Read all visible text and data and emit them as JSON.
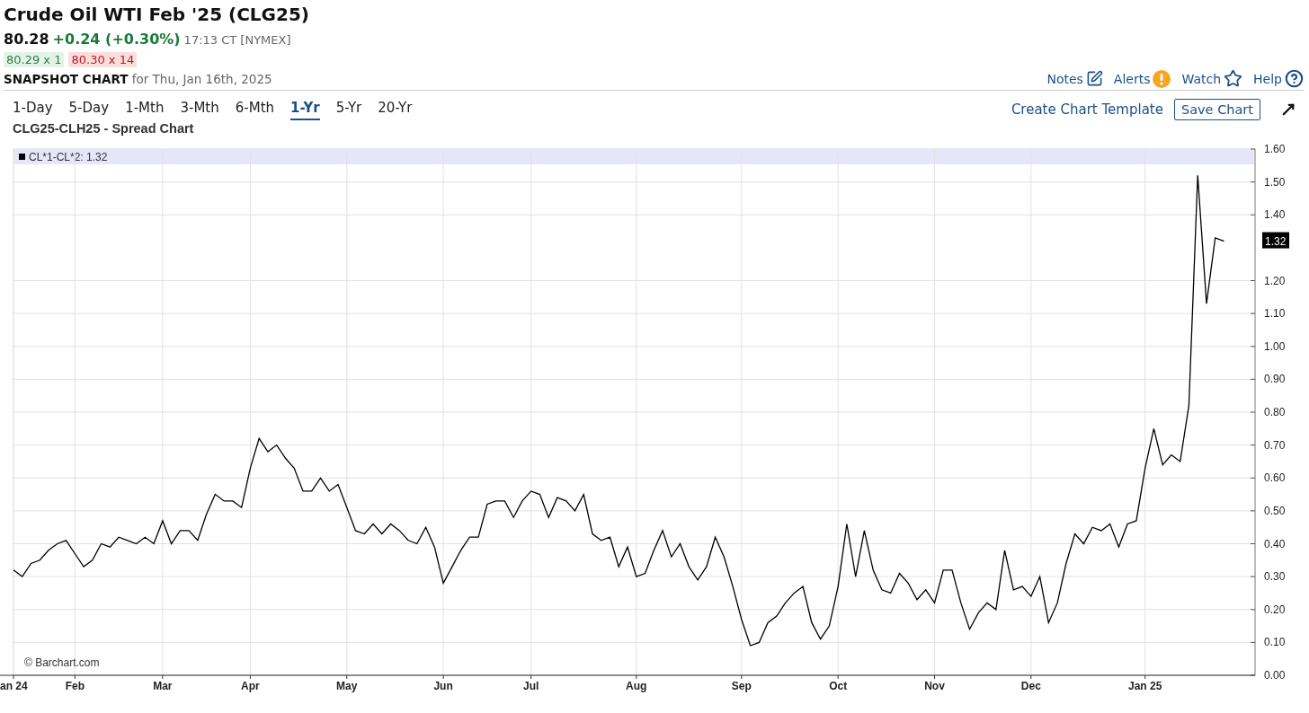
{
  "title": "Crude Oil WTI Feb '25 (CLG25)",
  "quote": {
    "last": "80.28",
    "change": "+0.24 (+0.30%)",
    "time": "17:13 CT [NYMEX]"
  },
  "bid": "80.29 x 1",
  "ask": "80.30 x 14",
  "snapshot": {
    "label": "SNAPSHOT CHART",
    "date": "for Thu, Jan 16th, 2025"
  },
  "header_links": [
    {
      "label": "Notes",
      "kind": "notes"
    },
    {
      "label": "Alerts",
      "kind": "alerts"
    },
    {
      "label": "Watch",
      "kind": "watch"
    },
    {
      "label": "Help",
      "kind": "help"
    }
  ],
  "ranges": [
    {
      "label": "1-Day",
      "selected": false
    },
    {
      "label": "5-Day",
      "selected": false
    },
    {
      "label": "1-Mth",
      "selected": false
    },
    {
      "label": "3-Mth",
      "selected": false
    },
    {
      "label": "6-Mth",
      "selected": false
    },
    {
      "label": "1-Yr",
      "selected": true
    },
    {
      "label": "5-Yr",
      "selected": false
    },
    {
      "label": "20-Yr",
      "selected": false
    }
  ],
  "actions": {
    "template": "Create Chart Template",
    "save": "Save Chart"
  },
  "chart": {
    "title": "CLG25-CLH25 - Spread Chart",
    "legend": "CL*1-CL*2: 1.32",
    "last_value_label": "1.32",
    "credit": "© Barchart.com",
    "chart_data": {
      "type": "line",
      "grid": true,
      "ylim": [
        0,
        1.6
      ],
      "categories": [
        "an 24",
        null,
        null,
        null,
        null,
        null,
        null,
        "Feb",
        null,
        null,
        null,
        null,
        null,
        null,
        null,
        null,
        null,
        "Mar",
        null,
        null,
        null,
        null,
        null,
        null,
        null,
        null,
        null,
        "Apr",
        null,
        null,
        null,
        null,
        null,
        null,
        null,
        null,
        null,
        null,
        "May",
        null,
        null,
        null,
        null,
        null,
        null,
        null,
        null,
        null,
        null,
        "Jun",
        null,
        null,
        null,
        null,
        null,
        null,
        null,
        null,
        null,
        "Jul",
        null,
        null,
        null,
        null,
        null,
        null,
        null,
        null,
        null,
        null,
        null,
        "Aug",
        null,
        null,
        null,
        null,
        null,
        null,
        null,
        null,
        null,
        null,
        null,
        "Sep",
        null,
        null,
        null,
        null,
        null,
        null,
        null,
        null,
        null,
        null,
        "Oct",
        null,
        null,
        null,
        null,
        null,
        null,
        null,
        null,
        null,
        null,
        "Nov",
        null,
        null,
        null,
        null,
        null,
        null,
        null,
        null,
        null,
        null,
        "Dec",
        null,
        null,
        null,
        null,
        null,
        null,
        null,
        null,
        null,
        null,
        null,
        null,
        "Jan 25",
        null,
        null,
        null,
        null,
        null,
        null,
        null,
        null,
        null
      ],
      "series": [
        {
          "color": "#000000",
          "values": [
            0.32,
            0.3,
            0.34,
            0.35,
            0.38,
            0.4,
            0.41,
            0.37,
            0.33,
            0.35,
            0.4,
            0.39,
            0.42,
            0.41,
            0.4,
            0.42,
            0.4,
            0.47,
            0.4,
            0.44,
            0.44,
            0.41,
            0.49,
            0.55,
            0.53,
            0.53,
            0.51,
            0.63,
            0.72,
            0.68,
            0.7,
            0.66,
            0.63,
            0.56,
            0.56,
            0.6,
            0.56,
            0.58,
            0.51,
            0.44,
            0.43,
            0.46,
            0.43,
            0.46,
            0.44,
            0.41,
            0.4,
            0.45,
            0.39,
            0.28,
            0.33,
            0.38,
            0.42,
            0.42,
            0.52,
            0.53,
            0.53,
            0.48,
            0.53,
            0.56,
            0.55,
            0.48,
            0.54,
            0.53,
            0.5,
            0.55,
            0.43,
            0.41,
            0.42,
            0.33,
            0.39,
            0.3,
            0.31,
            0.38,
            0.44,
            0.36,
            0.4,
            0.33,
            0.29,
            0.33,
            0.42,
            0.36,
            0.27,
            0.17,
            0.09,
            0.1,
            0.16,
            0.18,
            0.22,
            0.25,
            0.27,
            0.16,
            0.11,
            0.15,
            0.27,
            0.46,
            0.3,
            0.44,
            0.32,
            0.26,
            0.25,
            0.31,
            0.28,
            0.23,
            0.26,
            0.22,
            0.32,
            0.32,
            0.22,
            0.14,
            0.19,
            0.22,
            0.2,
            0.38,
            0.26,
            0.27,
            0.24,
            0.3,
            0.16,
            0.22,
            0.34,
            0.43,
            0.4,
            0.45,
            0.44,
            0.46,
            0.39,
            0.46,
            0.47,
            0.63,
            0.75,
            0.64,
            0.67,
            0.65,
            0.82,
            1.52,
            1.13,
            1.33,
            1.32
          ]
        }
      ],
      "yticks": [
        {
          "value": 0,
          "label": "0.00"
        },
        {
          "value": 0.1,
          "label": "0.10"
        },
        {
          "value": 0.2,
          "label": "0.20"
        },
        {
          "value": 0.3,
          "label": "0.30"
        },
        {
          "value": 0.4,
          "label": "0.40"
        },
        {
          "value": 0.5,
          "label": "0.50"
        },
        {
          "value": 0.6,
          "label": "0.60"
        },
        {
          "value": 0.7,
          "label": "0.70"
        },
        {
          "value": 0.8,
          "label": "0.80"
        },
        {
          "value": 0.9,
          "label": "0.90"
        },
        {
          "value": 1.0,
          "label": "1.00"
        },
        {
          "value": 1.1,
          "label": "1.10"
        },
        {
          "value": 1.2,
          "label": "1.20"
        },
        {
          "value": 1.4,
          "label": "1.40"
        },
        {
          "value": 1.5,
          "label": "1.50"
        },
        {
          "value": 1.6,
          "label": "1.60"
        }
      ]
    }
  }
}
